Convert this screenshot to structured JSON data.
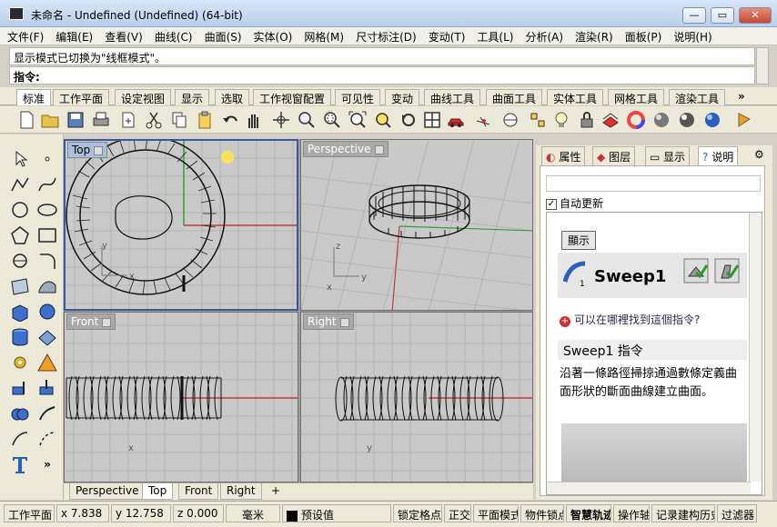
{
  "window": {
    "title": "未命名 - Undefined (Undefined) (64-bit)",
    "min": "—",
    "max": "▭",
    "close": "✕"
  },
  "menu": [
    "文件(F)",
    "编辑(E)",
    "查看(V)",
    "曲线(C)",
    "曲面(S)",
    "实体(O)",
    "网格(M)",
    "尺寸标注(D)",
    "变动(T)",
    "工具(L)",
    "分析(A)",
    "渲染(R)",
    "面板(P)",
    "说明(H)"
  ],
  "command": {
    "history": "显示模式已切换为\"线框模式\"。",
    "prompt": "指令:"
  },
  "toolbar_tabs": [
    "标准",
    "工作平面",
    "设定视图",
    "显示",
    "选取",
    "工作视窗配置",
    "可见性",
    "变动",
    "曲线工具",
    "曲面工具",
    "实体工具",
    "网格工具",
    "渲染工具"
  ],
  "toolbar_tabs_more": "»",
  "viewports": {
    "top": {
      "label": "Top"
    },
    "perspective": {
      "label": "Perspective"
    },
    "front": {
      "label": "Front"
    },
    "right": {
      "label": "Right"
    }
  },
  "viewport_tabs": [
    "Perspective",
    "Top",
    "Front",
    "Right"
  ],
  "viewport_tab_add": "+",
  "panel": {
    "tabs": [
      "属性",
      "图层",
      "显示",
      "说明"
    ],
    "auto_update": "自动更新",
    "show_button": "顯示",
    "command_title": "Sweep1",
    "where_link": "可以在哪裡找到這個指令?",
    "command_heading": "Sweep1 指令",
    "description": "沿著一條路徑掃掠通過數條定義曲面形狀的斷面曲線建立曲面。",
    "sub_number": "1"
  },
  "status": {
    "cplane": "工作平面",
    "x": "x 7.838",
    "y": "y 12.758",
    "z": "z 0.000",
    "unit": "毫米",
    "layer": "预设值",
    "osnap": "锁定格点",
    "ortho": "正交",
    "planar": "平面模式",
    "objsnap": "物件锁点",
    "smarttrack": "智慧轨迹",
    "gumball": "操作轴",
    "history": "记录建构历史",
    "filter": "过滤器"
  },
  "colors": {
    "accent": "#3a5a94",
    "viewport_bg": "#c9c9c9",
    "grid": "#b4b4b4",
    "xaxis": "#c23a3a",
    "yaxis": "#3a9a3a"
  }
}
